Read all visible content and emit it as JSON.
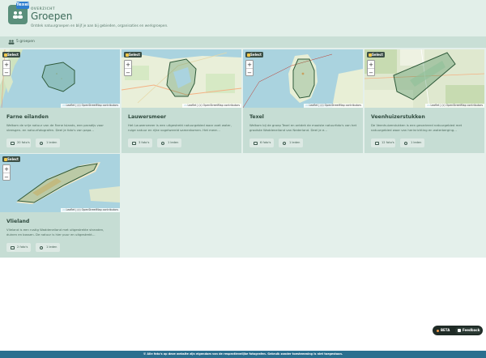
{
  "header": {
    "badge": "Texel",
    "breadcrumb": "OVERZICHT",
    "title": "Groepen",
    "subtitle": "Ontdek natuurgroepen en blijf je aan bij gebieden, organisaties en werkgroepen."
  },
  "count": {
    "text": "5 groepen"
  },
  "cards": [
    {
      "title": "Farne eilanden",
      "description": "Welkom de vrije natuur van de Farne Islands, een paradijs voor vleesgen- en natuurfotografen. Deel je foto's van papa…",
      "photos": "20 foto's",
      "members": "1 leden",
      "selected": "Select",
      "attribution": "Leaflet | (c) OpenStreetMap contributors"
    },
    {
      "title": "Lauwersmeer",
      "description": "Het Lauwersmeer is een uitgestrekt natuurgebied waar zoet water, ruige natuur en rijke vogelwereld samenkomen. Het meer…",
      "photos": "3 foto's",
      "members": "1 leden",
      "selected": "Select",
      "attribution": "Leaflet | (c) OpenStreetMap contributors"
    },
    {
      "title": "Texel",
      "description": "Welkom bij de groep Texel en ontdek de mooiste natuurfoto's van het grootste Waddeneiland van Nederland. Deel je e…",
      "photos": "6 foto's",
      "members": "1 leden",
      "selected": "Select",
      "attribution": "Leaflet | (c) OpenStreetMap contributors"
    },
    {
      "title": "Veenhuizerstukken",
      "description": "De Veenhuizerstukken is een gevarieerd natuurgebied met natuurgebied waar van herinrichting en waterberging…",
      "photos": "12 foto's",
      "members": "1 leden",
      "selected": "Select",
      "attribution": "Leaflet | (c) OpenStreetMap contributors"
    },
    {
      "title": "Vlieland",
      "description": "Vlieland is een rustig Waddeneiland met uitgestrekte stranden, duinen en bossen. De natuur is hier puur en uitgestrekt…",
      "photos": "2 foto's",
      "members": "1 leden",
      "selected": "Select",
      "attribution": "Leaflet | (c) OpenStreetMap contributors"
    }
  ],
  "widget": {
    "beta": "BETA",
    "feedback": "Feedback"
  },
  "footer": {
    "text": "© Alle foto's op deze website zijn eigendom van de respectievelijke fotografen. Gebruik zonder toestemming is niet toegestaan."
  },
  "colors": {
    "accent": "#5a8f7b",
    "card": "#c6ddd4",
    "footer": "#2a6f8f",
    "polygon": "#2f7a4a"
  },
  "icons": [
    "group-icon",
    "photo-icon",
    "member-icon",
    "zoom-in-icon",
    "zoom-out-icon",
    "feedback-icon"
  ]
}
